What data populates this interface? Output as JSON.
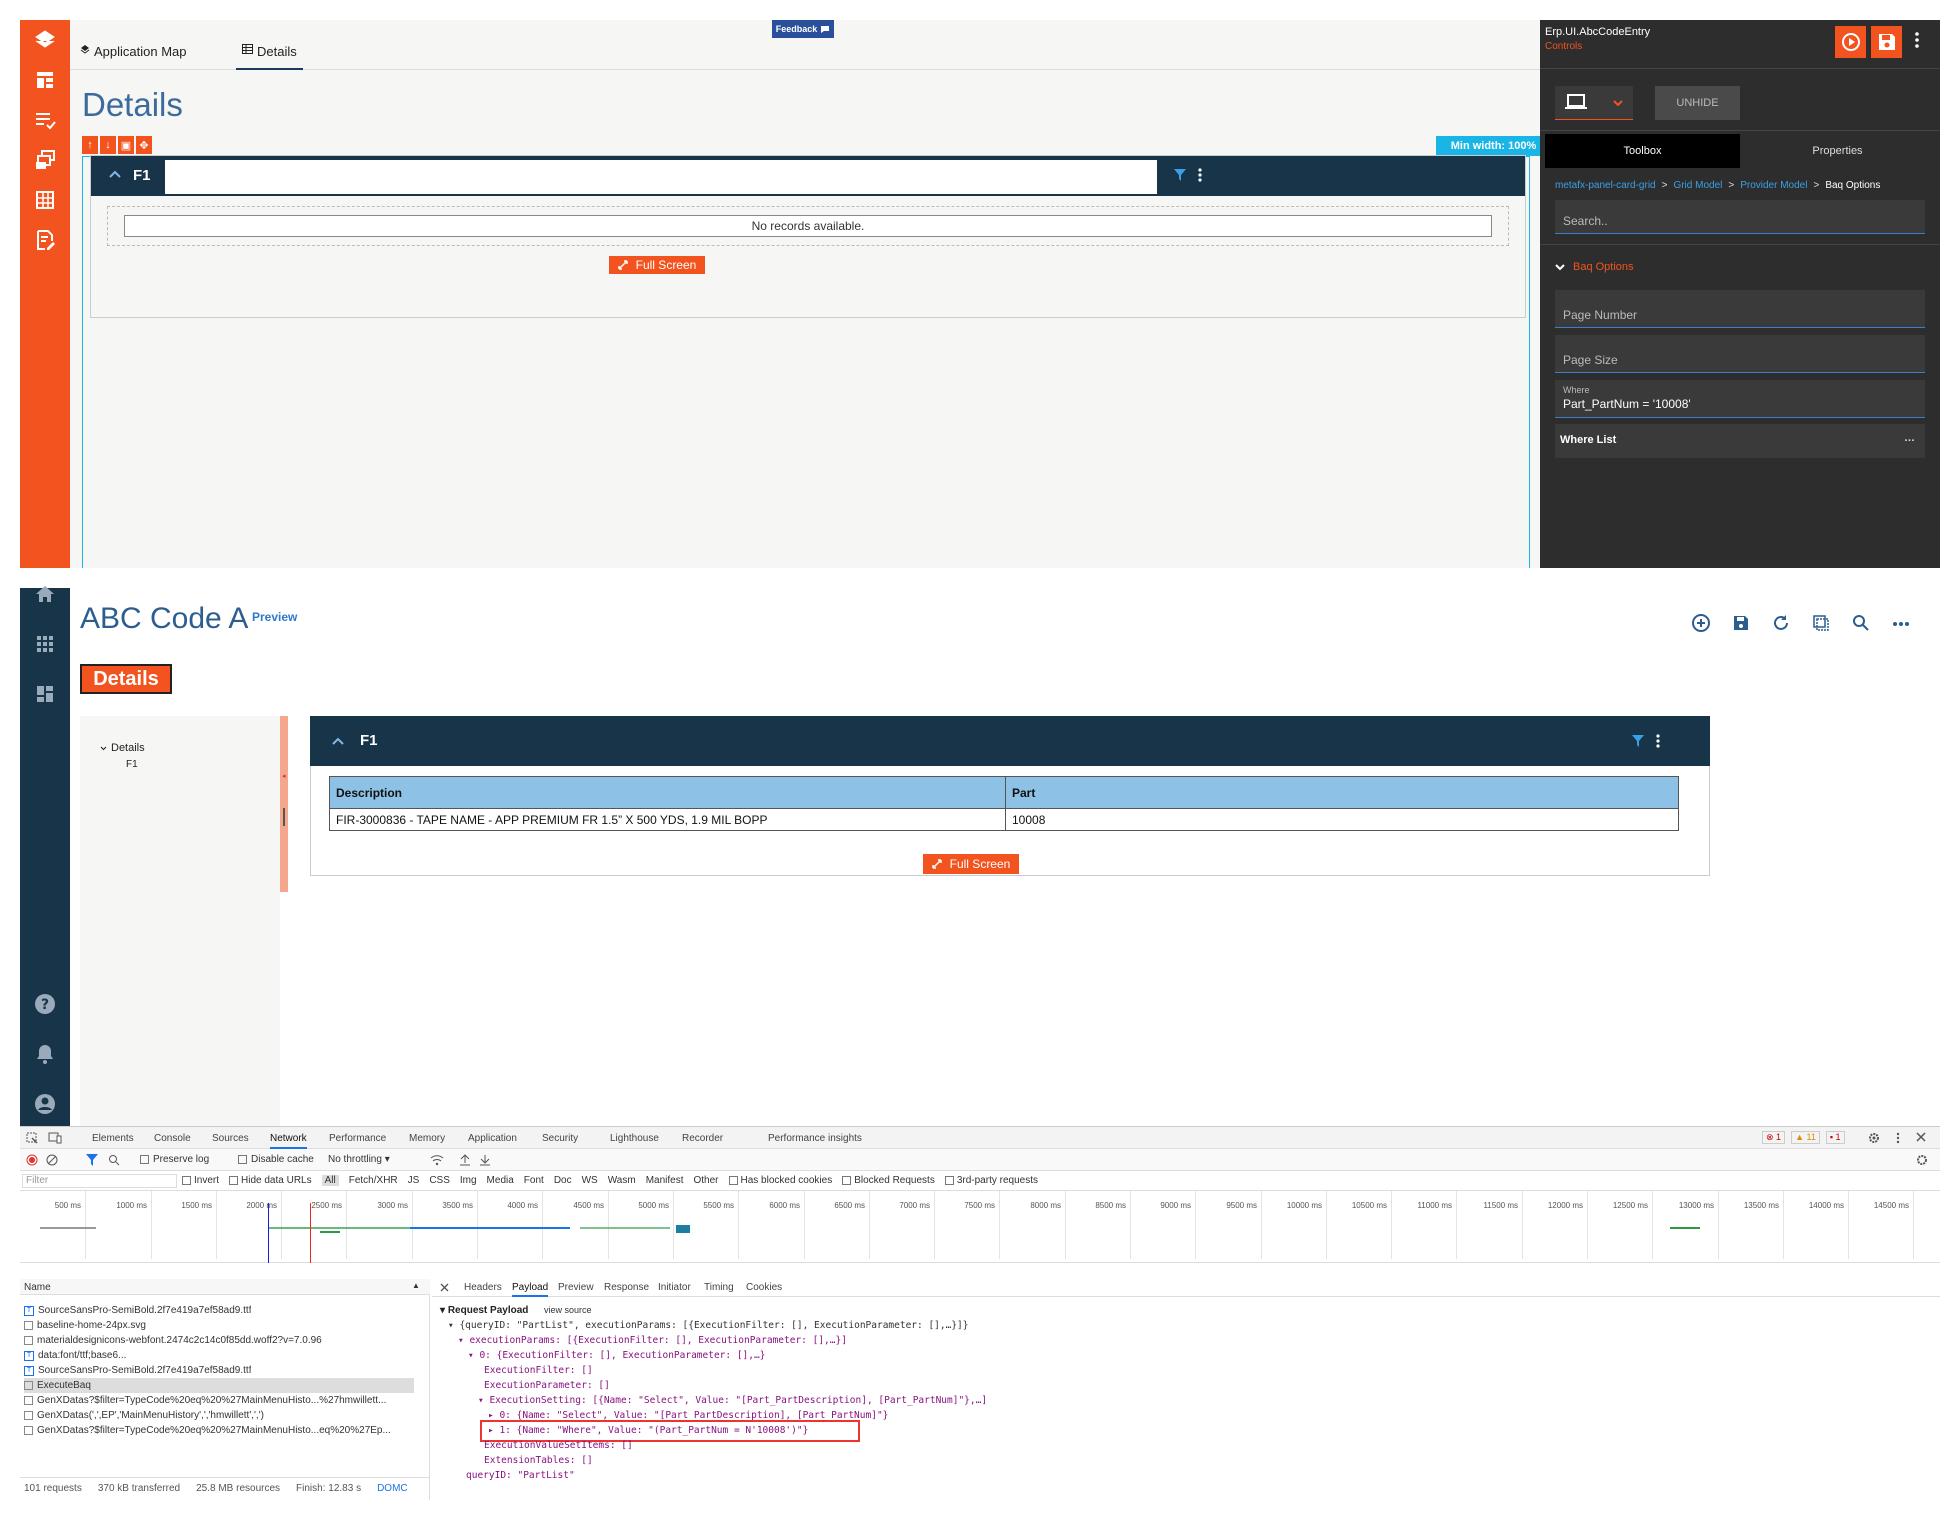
{
  "designer": {
    "tabs": {
      "app_map": "Application Map",
      "details": "Details"
    },
    "feedback_label": "Feedback",
    "page_title": "Details",
    "min_width_label": "Min width: 100%",
    "card_title": "F1",
    "no_records": "No records available.",
    "full_screen_label": "Full Screen",
    "rail_icons": [
      "layers-icon",
      "dashboard-icon",
      "list-check-icon",
      "stack-icon",
      "grid-icon",
      "edit-doc-icon"
    ],
    "panel": {
      "component": "Erp.UI.AbcCodeEntry",
      "subtitle": "Controls",
      "unhide_label": "UNHIDE",
      "tabs": {
        "toolbox": "Toolbox",
        "properties": "Properties"
      },
      "breadcrumb": [
        "metafx-panel-card-grid",
        "Grid Model",
        "Provider Model",
        "Baq Options"
      ],
      "breadcrumb_sep": ">",
      "search_placeholder": "Search..",
      "section_title": "Baq Options",
      "fields": {
        "page_number": "Page Number",
        "page_size": "Page Size",
        "where_label": "Where",
        "where_value": "Part_PartNum = '10008'",
        "where_list": "Where List",
        "where_list_more": "…"
      },
      "colors": {
        "accent": "#f2531f",
        "panel_bg": "#2d2d2d",
        "link": "#3aa0e6"
      }
    }
  },
  "preview": {
    "title": "ABC Code A",
    "preview_badge": "Preview",
    "details_button": "Details",
    "tree": {
      "root": "Details",
      "child": "F1"
    },
    "card_title": "F1",
    "grid": {
      "columns": [
        "Description",
        "Part"
      ],
      "rows": [
        [
          "FIR-3000836 - TAPE NAME - APP PREMIUM FR 1.5” X 500 YDS, 1.9 MIL BOPP",
          "10008"
        ]
      ]
    },
    "full_screen_label": "Full Screen",
    "toolbar_icons": [
      "add-circle-icon",
      "save-icon",
      "refresh-icon",
      "copy-icon",
      "search-icon",
      "more-icon"
    ]
  },
  "devtools": {
    "tabs": [
      "Elements",
      "Console",
      "Sources",
      "Network",
      "Performance",
      "Memory",
      "Application",
      "Security",
      "Lighthouse",
      "Recorder",
      "Performance insights"
    ],
    "active_tab": "Network",
    "badges": {
      "errors": "1",
      "warnings": "11",
      "issues": "1"
    },
    "toolbar": {
      "preserve_log": "Preserve log",
      "disable_cache": "Disable cache",
      "throttling": "No throttling"
    },
    "filter_bar": {
      "placeholder": "Filter",
      "invert": "Invert",
      "hide_data_urls": "Hide data URLs",
      "types": [
        "All",
        "Fetch/XHR",
        "JS",
        "CSS",
        "Img",
        "Media",
        "Font",
        "Doc",
        "WS",
        "Wasm",
        "Manifest",
        "Other"
      ],
      "blocked_cookies": "Has blocked cookies",
      "blocked_requests": "Blocked Requests",
      "third_party": "3rd-party requests"
    },
    "timeline_ticks": [
      "500 ms",
      "1000 ms",
      "1500 ms",
      "2000 ms",
      "2500 ms",
      "3000 ms",
      "3500 ms",
      "4000 ms",
      "4500 ms",
      "5000 ms",
      "5500 ms",
      "6000 ms",
      "6500 ms",
      "7000 ms",
      "7500 ms",
      "8000 ms",
      "8500 ms",
      "9000 ms",
      "9500 ms",
      "10000 ms",
      "10500 ms",
      "11000 ms",
      "11500 ms",
      "12000 ms",
      "12500 ms",
      "13000 ms",
      "13500 ms",
      "14000 ms",
      "14500 ms"
    ],
    "name_header": "Name",
    "requests": [
      {
        "name": "SourceSansPro-SemiBold.2f7e419a7ef58ad9.ttf",
        "type": "font"
      },
      {
        "name": "baseline-home-24px.svg",
        "type": "plain"
      },
      {
        "name": "materialdesignicons-webfont.2474c2c14c0f85dd.woff2?v=7.0.96",
        "type": "plain"
      },
      {
        "name": "data:font/ttf;base6...",
        "type": "font"
      },
      {
        "name": "SourceSansPro-SemiBold.2f7e419a7ef58ad9.ttf",
        "type": "font"
      },
      {
        "name": "ExecuteBaq",
        "type": "plain"
      },
      {
        "name": "GenXDatas?$filter=TypeCode%20eq%20%27MainMenuHisto...%27hmwillett...",
        "type": "plain"
      },
      {
        "name": "GenXDatas(',',EP','MainMenuHistory',','hmwillett',',')",
        "type": "plain"
      },
      {
        "name": "GenXDatas?$filter=TypeCode%20eq%20%27MainMenuHisto...eq%20%27Ep...",
        "type": "plain"
      }
    ],
    "status": {
      "requests": "101 requests",
      "transferred": "370 kB transferred",
      "resources": "25.8 MB resources",
      "finish": "Finish: 12.83 s",
      "dom": "DOMC"
    },
    "detail_tabs": [
      "Headers",
      "Payload",
      "Preview",
      "Response",
      "Initiator",
      "Timing",
      "Cookies"
    ],
    "active_detail_tab": "Payload",
    "payload": {
      "title": "Request Payload",
      "view_source": "view source",
      "lines": [
        "{queryID: \"PartList\", executionParams: [{ExecutionFilter: [], ExecutionParameter: [],…}]}",
        "executionParams: [{ExecutionFilter: [], ExecutionParameter: [],…}]",
        "0: {ExecutionFilter: [], ExecutionParameter: [],…}",
        "ExecutionFilter: []",
        "ExecutionParameter: []",
        "ExecutionSetting: [{Name: \"Select\", Value: \"[Part_PartDescription], [Part_PartNum]\"},…]",
        "0: {Name: \"Select\", Value: \"[Part_PartDescription], [Part_PartNum]\"}",
        "1: {Name: \"Where\", Value: \"(Part_PartNum = N'10008')\"}",
        "ExecutionValueSetItems: []",
        "ExtensionTables: []",
        "queryID: \"PartList\""
      ]
    }
  }
}
